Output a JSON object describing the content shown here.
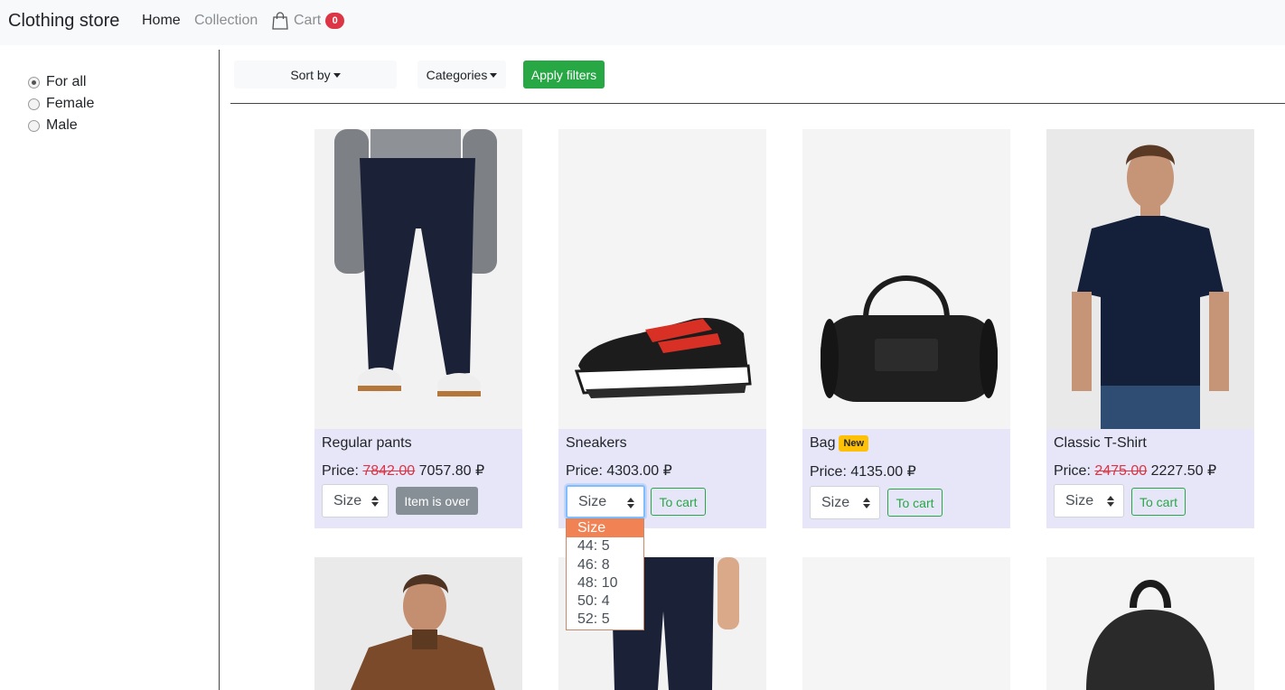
{
  "navbar": {
    "brand": "Clothing store",
    "home": "Home",
    "collection": "Collection",
    "cart_label": "Cart",
    "cart_count": "0",
    "cart_icon": "shopping-bag-icon"
  },
  "sidebar": {
    "options": [
      {
        "label": "For all",
        "checked": true
      },
      {
        "label": "Female",
        "checked": false
      },
      {
        "label": "Male",
        "checked": false
      }
    ]
  },
  "filters": {
    "sort_label": "Sort by",
    "categories_label": "Categories",
    "apply_label": "Apply filters"
  },
  "products": [
    {
      "title": "Regular pants",
      "price_label": "Price:",
      "old_price": "7842.00",
      "price": "7057.80 ₽",
      "size_label": "Size",
      "action": "Item is over",
      "badge": ""
    },
    {
      "title": "Sneakers",
      "price_label": "Price:",
      "old_price": "",
      "price": "4303.00 ₽",
      "size_label": "Size",
      "action": "To cart",
      "badge": ""
    },
    {
      "title": "Bag",
      "price_label": "Price:",
      "old_price": "",
      "price": "4135.00 ₽",
      "size_label": "Size",
      "action": "To cart",
      "badge": "New"
    },
    {
      "title": "Classic T-Shirt",
      "price_label": "Price:",
      "old_price": "2475.00",
      "price": "2227.50 ₽",
      "size_label": "Size",
      "action": "To cart",
      "badge": ""
    }
  ],
  "size_dropdown": {
    "options": [
      "Size",
      "44: 5",
      "46: 8",
      "48: 10",
      "50: 4",
      "52: 5"
    ],
    "selected": "Size"
  },
  "colors": {
    "accent_green": "#28a745",
    "danger_red": "#dc3545",
    "badge_yellow": "#ffc107",
    "card_body": "#e6e6f8"
  }
}
